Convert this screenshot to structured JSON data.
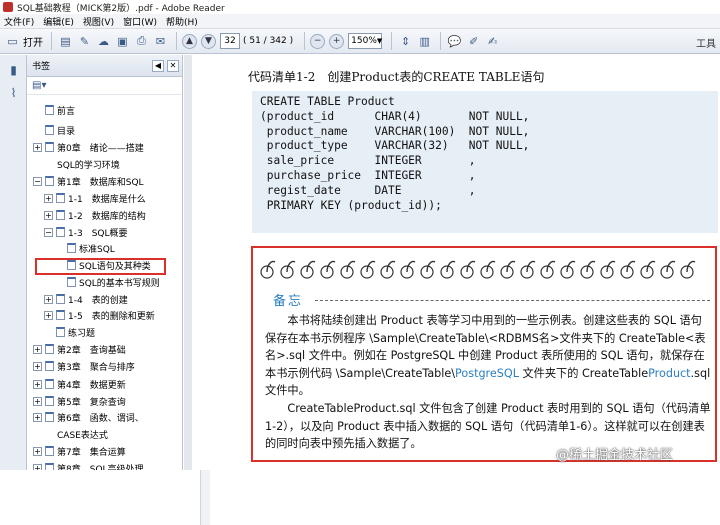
{
  "window": {
    "title": "SQL基础教程（MICK第2版）.pdf - Adobe Reader"
  },
  "menu": [
    "文件(F)",
    "编辑(E)",
    "视图(V)",
    "窗口(W)",
    "帮助(H)"
  ],
  "toolbar": {
    "open_label": "打开",
    "page_current": "32",
    "page_info": "( 51 / 342 )",
    "zoom": "150%",
    "tools_label": "工具"
  },
  "panel": {
    "title": "书签"
  },
  "bookmarks": [
    {
      "label": "前言",
      "depth": 0,
      "expander": ""
    },
    {
      "label": "目录",
      "depth": 0,
      "expander": ""
    },
    {
      "label": "第0章　绪论——搭建",
      "depth": 0,
      "expander": "+"
    },
    {
      "label": "SQL的学习环境",
      "depth": 0,
      "expander": "cont"
    },
    {
      "label": "第1章　数据库和SQL",
      "depth": 0,
      "expander": "-"
    },
    {
      "label": "1-1　数据库是什么",
      "depth": 1,
      "expander": "+"
    },
    {
      "label": "1-2　数据库的结构",
      "depth": 1,
      "expander": "+"
    },
    {
      "label": "1-3　SQL概要",
      "depth": 1,
      "expander": "-"
    },
    {
      "label": "标准SQL",
      "depth": 2,
      "expander": ""
    },
    {
      "label": "SQL语句及其种类",
      "depth": 2,
      "expander": ""
    },
    {
      "label": "SQL的基本书写规则",
      "depth": 2,
      "expander": ""
    },
    {
      "label": "1-4　表的创建",
      "depth": 1,
      "expander": "+"
    },
    {
      "label": "1-5　表的删除和更新",
      "depth": 1,
      "expander": "+"
    },
    {
      "label": "练习题",
      "depth": 1,
      "expander": ""
    },
    {
      "label": "第2章　查询基础",
      "depth": 0,
      "expander": "+"
    },
    {
      "label": "第3章　聚合与排序",
      "depth": 0,
      "expander": "+"
    },
    {
      "label": "第4章　数据更新",
      "depth": 0,
      "expander": "+"
    },
    {
      "label": "第5章　复杂查询",
      "depth": 0,
      "expander": "+"
    },
    {
      "label": "第6章　函数、谓词、",
      "depth": 0,
      "expander": "+"
    },
    {
      "label": "CASE表达式",
      "depth": 0,
      "expander": "cont"
    },
    {
      "label": "第7章　集合运算",
      "depth": 0,
      "expander": "+"
    },
    {
      "label": "第8章　SQL高级处理",
      "depth": 0,
      "expander": "+"
    }
  ],
  "document": {
    "code_title": "代码清单1-2　创建Product表的CREATE TABLE语句",
    "code_lines": [
      "CREATE TABLE Product",
      "(product_id      CHAR(4)       NOT NULL,",
      " product_name    VARCHAR(100)  NOT NULL,",
      " product_type    VARCHAR(32)   NOT NULL,",
      " sale_price      INTEGER       ,",
      " purchase_price  INTEGER       ,",
      " regist_date     DATE          ,",
      " PRIMARY KEY (product_id));"
    ],
    "note_title": "备忘",
    "note_p1_a": "本书将陆续创建出 Product 表等学习中用到的一些示例表。创建这些表的 SQL 语句保存在本书示例程序 \\Sample\\CreateTable\\<RDBMS名>文件夹下的 CreateTable<表名>.sql 文件中。例如在 PostgreSQL 中创建 Product 表所使用的 SQL 语句，就保存在本书示例代码 \\Sample\\CreateTable\\",
    "note_p1_blue1": "PostgreSQL",
    "note_p1_b": " 文件夹下的 CreateTable",
    "note_p1_blue2": "Product",
    "note_p1_c": ".sql 文件中。",
    "note_p2": "CreateTableProduct.sql 文件包含了创建 Product 表时用到的 SQL 语句（代码清单1-2），以及向 Product 表中插入数据的 SQL 语句（代码清单1-6）。这样就可以在创建表的同时向表中预先插入数据了。",
    "watermark": "@稀土掘金技术社区"
  }
}
